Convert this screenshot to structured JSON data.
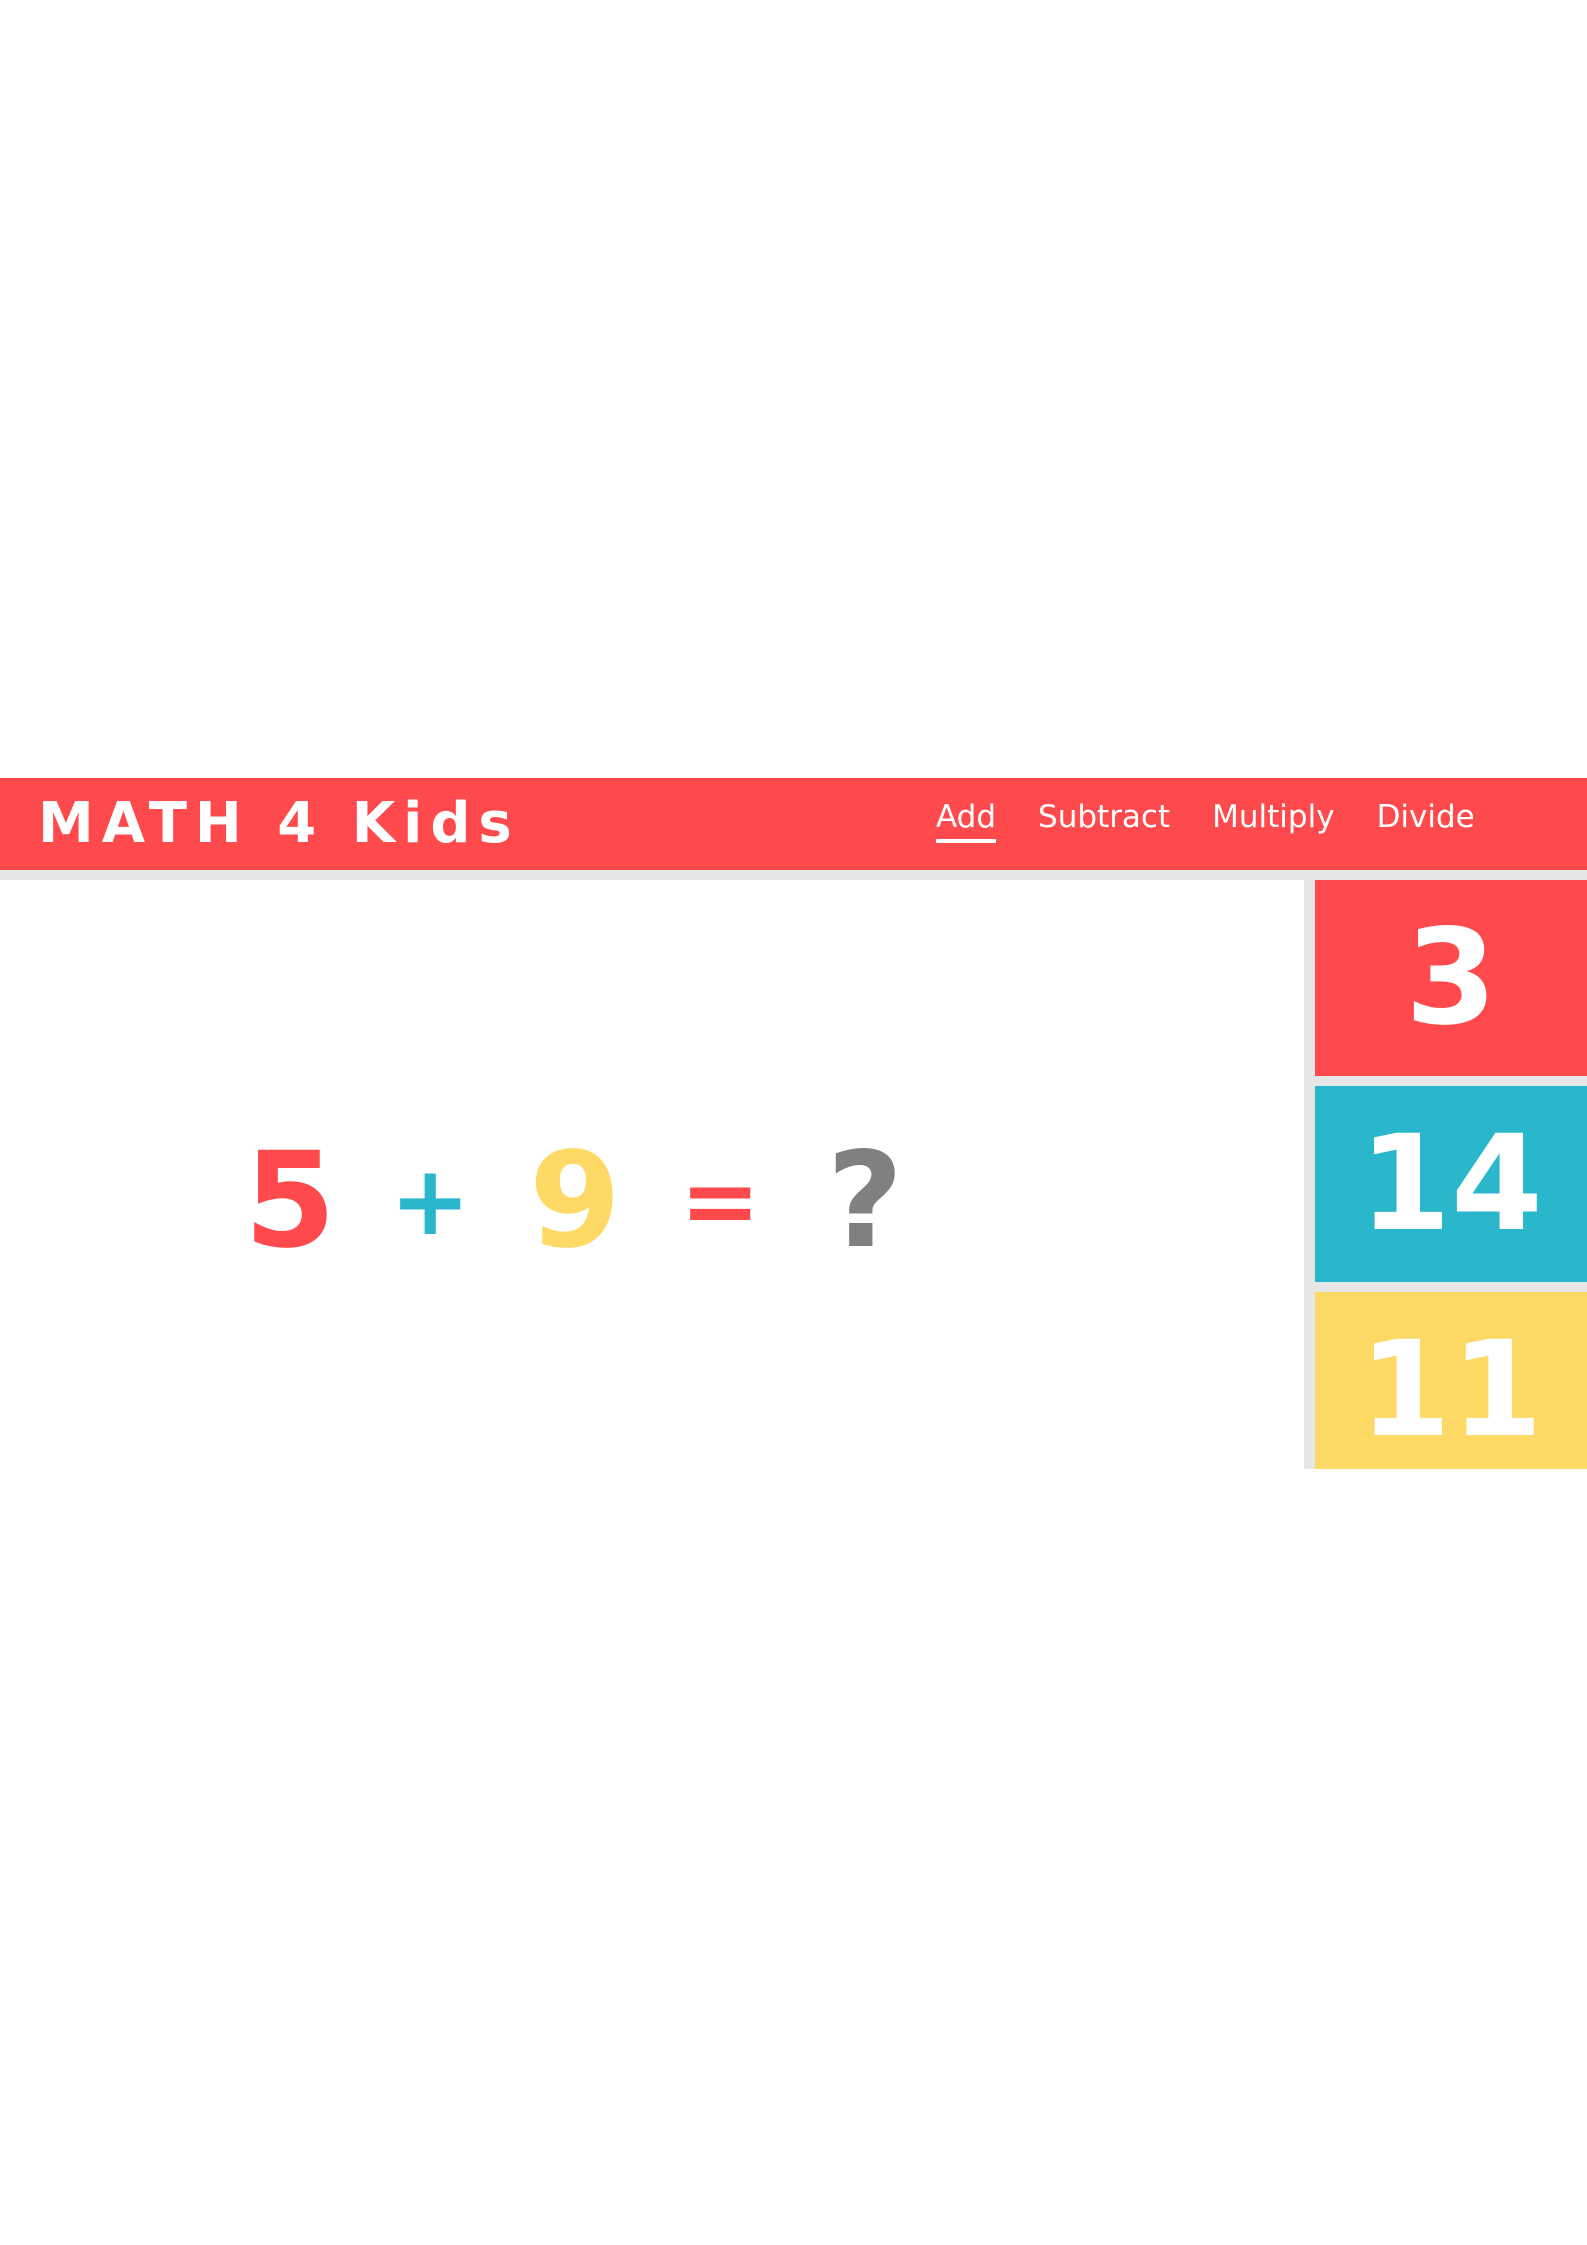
{
  "header": {
    "logo": "MATH 4 Kids",
    "nav": [
      {
        "label": "Add",
        "active": true
      },
      {
        "label": "Subtract",
        "active": false
      },
      {
        "label": "Multiply",
        "active": false
      },
      {
        "label": "Divide",
        "active": false
      }
    ]
  },
  "equation": {
    "operand_a": "5",
    "operator": "+",
    "operand_b": "9",
    "equals": "=",
    "unknown": "?"
  },
  "answers": [
    {
      "value": "3",
      "color": "#ff4a4d"
    },
    {
      "value": "14",
      "color": "#2bb7cb"
    },
    {
      "value": "11",
      "color": "#ffd966"
    }
  ],
  "colors": {
    "brand_red": "#ff4a4d",
    "teal": "#2bb7cb",
    "yellow": "#ffd966",
    "gray": "#808080",
    "divider": "#e6e6e6"
  }
}
